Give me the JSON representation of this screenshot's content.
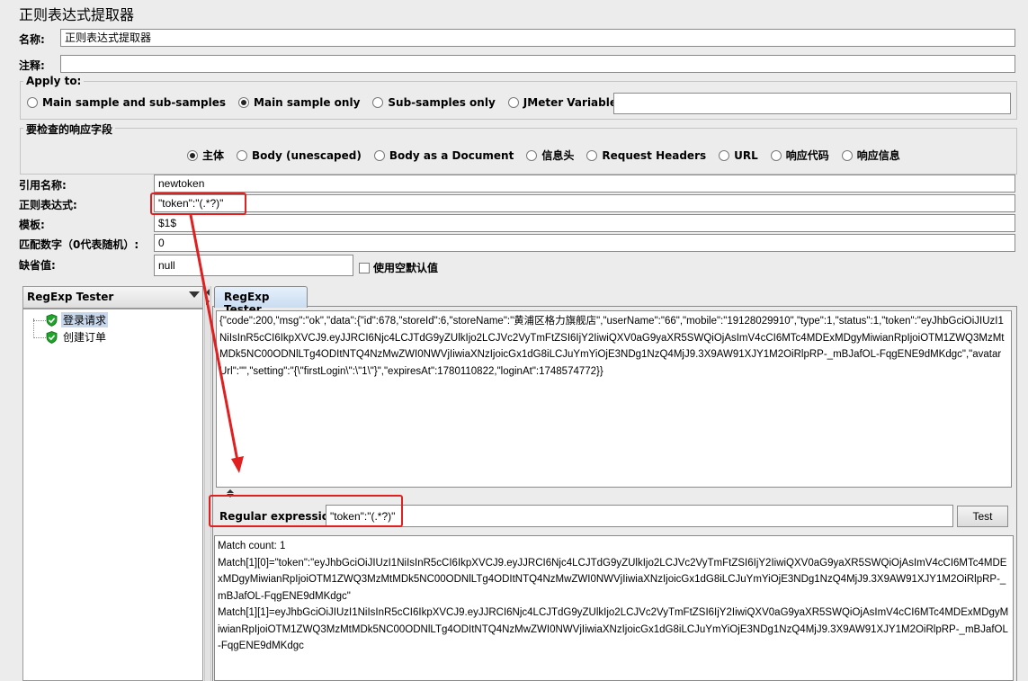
{
  "panel_title": "正则表达式提取器",
  "name": {
    "label": "名称:",
    "value": "正则表达式提取器"
  },
  "comment": {
    "label": "注释:",
    "value": ""
  },
  "apply_to": {
    "title": "Apply to:",
    "options": [
      "Main sample and sub-samples",
      "Main sample only",
      "Sub-samples only",
      "JMeter Variable Name to use"
    ],
    "selected": "Main sample only",
    "variable_value": ""
  },
  "field_to_check": {
    "title": "要检查的响应字段",
    "options": [
      "主体",
      "Body (unescaped)",
      "Body as a Document",
      "信息头",
      "Request Headers",
      "URL",
      "响应代码",
      "响应信息"
    ],
    "selected": "主体"
  },
  "ref_name": {
    "label": "引用名称:",
    "value": "newtoken"
  },
  "regex": {
    "label": "正则表达式:",
    "value": "\"token\":\"(.*?)\""
  },
  "template": {
    "label": "模板:",
    "value": "$1$"
  },
  "match_no": {
    "label": "匹配数字（0代表随机）:",
    "value": "0"
  },
  "default_value": {
    "label": "缺省值:",
    "value": "null",
    "use_empty_label": "使用空默认值"
  },
  "view_selector": {
    "label": "RegExp Tester"
  },
  "tree": {
    "items": [
      "登录请求",
      "创建订单"
    ]
  },
  "tester": {
    "tab_label": "RegExp Tester",
    "response_text": "{\"code\":200,\"msg\":\"ok\",\"data\":{\"id\":678,\"storeId\":6,\"storeName\":\"黄浦区格力旗舰店\",\"userName\":\"66\",\"mobile\":\"19128029910\",\"type\":1,\"status\":1,\"token\":\"eyJhbGciOiJIUzI1NiIsInR5cCI6IkpXVCJ9.eyJJRCI6Njc4LCJTdG9yZUlkIjo2LCJVc2VyTmFtZSI6IjY2IiwiQXV0aG9yaXR5SWQiOjAsImV4cCI6MTc4MDExMDgyMiwianRpIjoiOTM1ZWQ3MzMtMDk5NC00ODNlLTg4ODItNTQ4NzMwZWI0NWVjIiwiaXNzIjoicGx1dG8iLCJuYmYiOjE3NDg1NzQ4MjJ9.3X9AW91XJY1M2OiRlpRP-_mBJafOL-FqgENE9dMKdgc\",\"avatarUrl\":\"\",\"setting\":\"{\\\"firstLogin\\\":\\\"1\\\"}\",\"expiresAt\":1780110822,\"loginAt\":1748574772}}",
    "regex_label": "Regular expression:",
    "regex_value": "\"token\":\"(.*?)\"",
    "test_button": "Test",
    "results": {
      "line1": "Match count: 1",
      "line2": "Match[1][0]=\"token\":\"eyJhbGciOiJIUzI1NiIsInR5cCI6IkpXVCJ9.eyJJRCI6Njc4LCJTdG9yZUlkIjo2LCJVc2VyTmFtZSI6IjY2IiwiQXV0aG9yaXR5SWQiOjAsImV4cCI6MTc4MDExMDgyMiwianRpIjoiOTM1ZWQ3MzMtMDk5NC00ODNlLTg4ODItNTQ4NzMwZWI0NWVjIiwiaXNzIjoicGx1dG8iLCJuYmYiOjE3NDg1NzQ4MjJ9.3X9AW91XJY1M2OiRlpRP-_mBJafOL-FqgENE9dMKdgc\"",
      "line3": "Match[1][1]=eyJhbGciOiJIUzI1NiIsInR5cCI6IkpXVCJ9.eyJJRCI6Njc4LCJTdG9yZUlkIjo2LCJVc2VyTmFtZSI6IjY2IiwiQXV0aG9yaXR5SWQiOjAsImV4cCI6MTc4MDExMDgyMiwianRpIjoiOTM1ZWQ3MzMtMDk5NC00ODNlLTg4ODItNTQ4NzMwZWI0NWVjIiwiaXNzIjoicGx1dG8iLCJuYmYiOjE3NDg1NzQ4MjJ9.3X9AW91XJY1M2OiRlpRP-_mBJafOL-FqgENE9dMKdgc"
    }
  },
  "annotation_color": "#e02020"
}
